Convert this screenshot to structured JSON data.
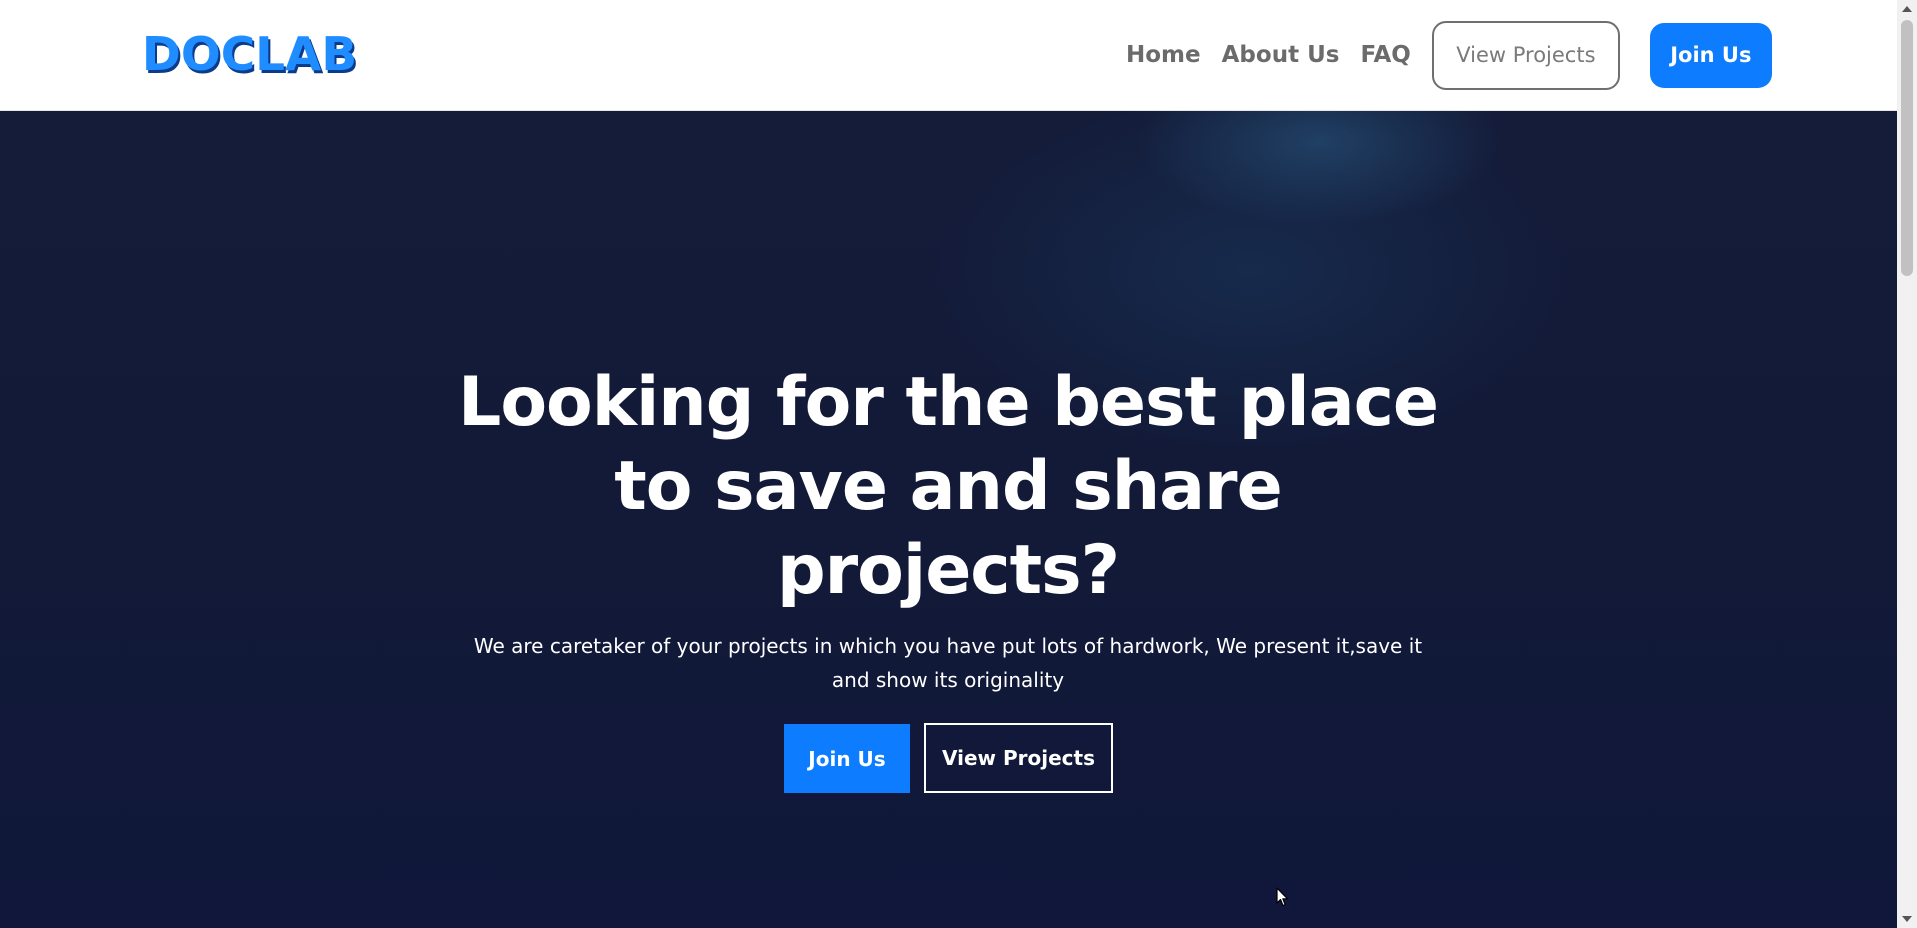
{
  "header": {
    "logo_text": "DOCLAB",
    "nav": {
      "home": "Home",
      "about": "About Us",
      "faq": "FAQ"
    },
    "view_projects_label": "View Projects",
    "join_label": "Join Us"
  },
  "hero": {
    "title": "Looking for the best place to save and share projects?",
    "subtitle": "We are caretaker of your projects in which you have put lots of hardwork, We present it,save it and show its originality",
    "join_label": "Join Us",
    "view_projects_label": "View Projects"
  },
  "colors": {
    "brand": "#1f8cff",
    "primary": "#0d7cff",
    "hero_bg": "#131b39",
    "nav_text": "#6b6b6b"
  },
  "icons": {
    "cursor": "mouse-pointer-icon",
    "scroll_up": "arrow-up-icon",
    "scroll_down": "arrow-down-icon"
  }
}
